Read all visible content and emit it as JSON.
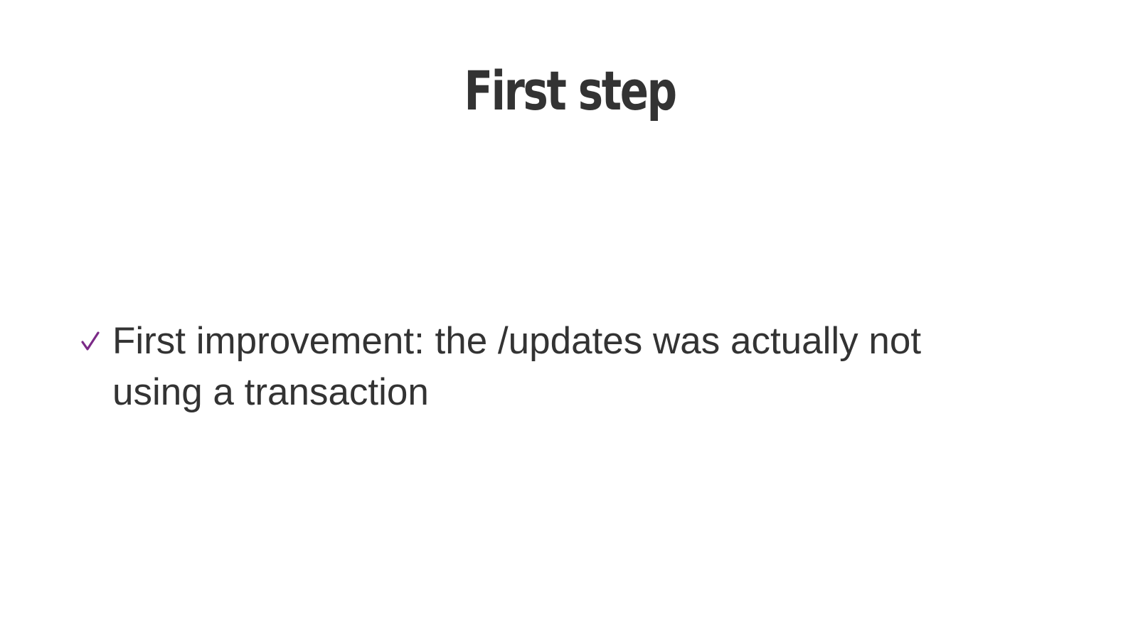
{
  "slide": {
    "title": "First step",
    "bullets": [
      {
        "icon": "checkmark-icon",
        "icon_color": "#7b2a87",
        "text": "First improvement: the /updates was actually not using a transaction"
      }
    ]
  },
  "colors": {
    "text": "#333333",
    "accent": "#7b2a87",
    "background": "#ffffff"
  }
}
